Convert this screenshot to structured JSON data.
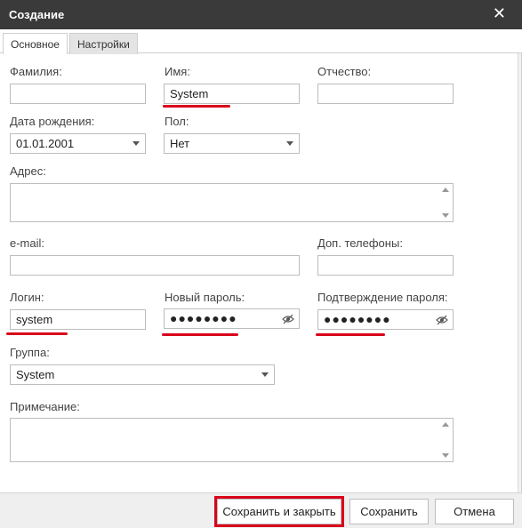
{
  "dialog": {
    "title": "Создание",
    "close_glyph": "✕",
    "tabs": [
      {
        "label": "Основное",
        "active": true
      },
      {
        "label": "Настройки",
        "active": false
      }
    ]
  },
  "form": {
    "last_name": {
      "label": "Фамилия:",
      "value": ""
    },
    "first_name": {
      "label": "Имя:",
      "value": "System"
    },
    "middle_name": {
      "label": "Отчество:",
      "value": ""
    },
    "birth_date": {
      "label": "Дата рождения:",
      "value": "01.01.2001"
    },
    "gender": {
      "label": "Пол:",
      "value": "Нет"
    },
    "address": {
      "label": "Адрес:",
      "value": ""
    },
    "email": {
      "label": "e-mail:",
      "value": ""
    },
    "extra_phones": {
      "label": "Доп. телефоны:",
      "value": ""
    },
    "login": {
      "label": "Логин:",
      "value": "system"
    },
    "new_password": {
      "label": "Новый пароль:",
      "value": "●●●●●●●●"
    },
    "confirm_password": {
      "label": "Подтверждение пароля:",
      "value": "●●●●●●●●"
    },
    "group": {
      "label": "Группа:",
      "value": "System"
    },
    "note": {
      "label": "Примечание:",
      "value": ""
    }
  },
  "footer": {
    "save_close_label": "Сохранить и закрыть",
    "save_label": "Сохранить",
    "cancel_label": "Отмена"
  },
  "colors": {
    "titlebar": "#3a3a3a",
    "highlight": "#d9001b",
    "field_border": "#bdbdbd"
  },
  "icons": {
    "close": "close-icon",
    "dropdown": "chevron-down-icon",
    "reveal_password": "eye-icon",
    "scroll_up": "scroll-up-icon",
    "scroll_down": "scroll-down-icon"
  }
}
